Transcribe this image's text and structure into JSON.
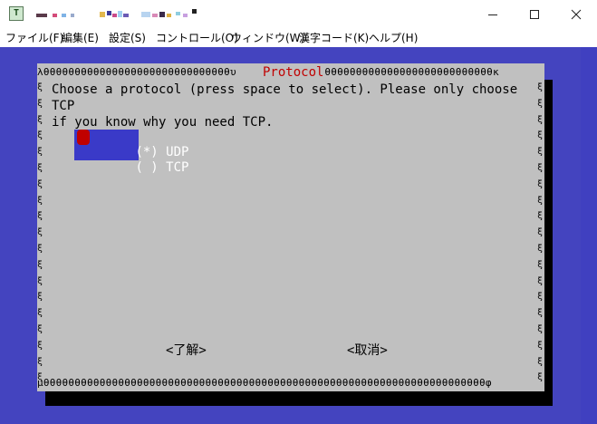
{
  "window": {
    "icon_letter": "T",
    "controls": {
      "minimize": "minimize",
      "maximize": "maximize",
      "close": "close"
    }
  },
  "menubar": {
    "items": [
      "ファイル(F)",
      "編集(E)",
      "設定(S)",
      "コントロール(O)",
      "ウィンドウ(W)",
      "漢字コード(K)",
      "ヘルプ(H)"
    ]
  },
  "dialog": {
    "title": "Protocol",
    "border_top_left": "λθθθθθθθθθθθθθθθθθθθθθθθθθθθθθθυ",
    "border_top_right": "τθθθθθθθθθθθθθθθθθθθθθθθθθθθθθθκ",
    "border_bottom": "μθθθθθθθθθθθθθθθθθθθθθθθθθθθθθθθθθθθθθθθθθθθθθθθθθθθθθθθθθθθθθθθθθθθθθθθφ",
    "side_glyph": "ξ",
    "prompt": "Choose a protocol (press space to select). Please only choose TCP\nif you know why you need TCP.",
    "options": [
      {
        "mark": "(*)",
        "label": "UDP",
        "selected": true
      },
      {
        "mark": "( )",
        "label": "TCP",
        "selected": false
      }
    ],
    "ok_button": "<了解>",
    "cancel_button": "<取消>"
  },
  "colors": {
    "terminal_bg": "#4444bf",
    "dialog_bg": "#c0c0c0",
    "title_fg": "#c00000",
    "selection_bg": "#3a3ac8",
    "cursor": "#c00000"
  }
}
